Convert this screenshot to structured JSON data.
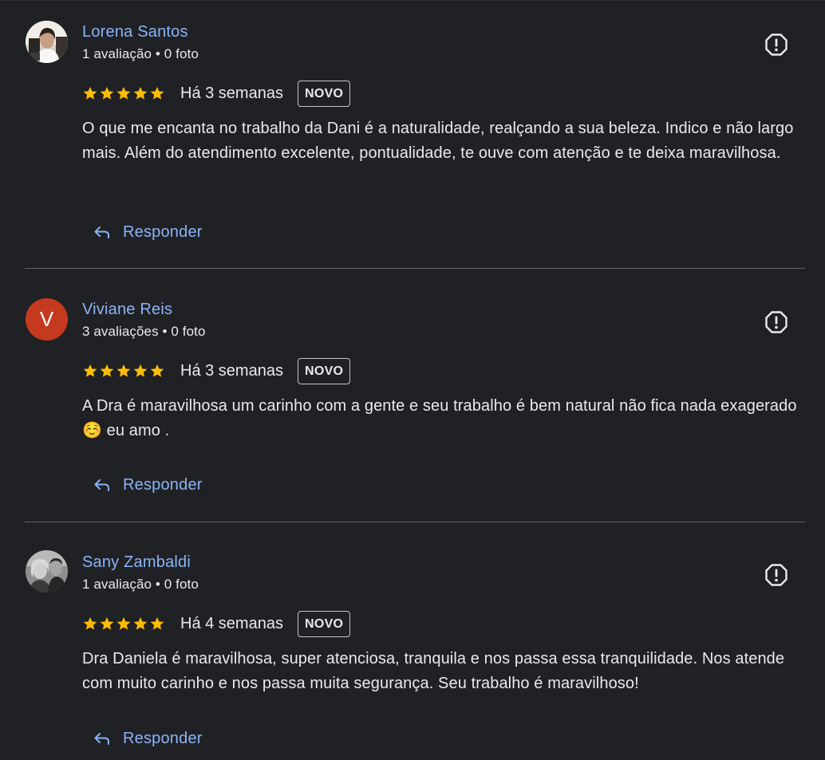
{
  "reviews": [
    {
      "name": "Lorena Santos",
      "meta": "1 avaliação • 0 foto",
      "avatar_type": "photo",
      "rating": 5,
      "date": "Há 3 semanas",
      "badge": "NOVO",
      "text": "O que me encanta no trabalho da Dani é a naturalidade, realçando a sua beleza. Indico e não largo mais. Além do atendimento excelente, pontualidade, te ouve com atenção e te deixa maravilhosa.",
      "reply_label": "Responder"
    },
    {
      "name": "Viviane Reis",
      "meta": "3 avaliações • 0 foto",
      "avatar_type": "letter",
      "avatar_letter": "V",
      "avatar_color": "#c5391f",
      "rating": 5,
      "date": "Há 3 semanas",
      "badge": "NOVO",
      "text": "A Dra é maravilhosa um carinho com a gente e seu trabalho é bem natural não fica nada exagerado ☺️ eu amo .",
      "reply_label": "Responder"
    },
    {
      "name": "Sany Zambaldi",
      "meta": "1 avaliação • 0 foto",
      "avatar_type": "photo",
      "rating": 5,
      "date": "Há 4 semanas",
      "badge": "NOVO",
      "text": "Dra Daniela é maravilhosa, super atenciosa, tranquila e nos passa essa tranquilidade. Nos atende com muito carinho e nos passa muita segurança. Seu trabalho é maravilhoso!",
      "reply_label": "Responder"
    }
  ],
  "icons": {
    "flag": "report-flag-icon",
    "star": "star-icon",
    "reply": "reply-arrow-icon"
  },
  "colors": {
    "background": "#202124",
    "link": "#8ab4f8",
    "star": "#fbbc04",
    "text": "#e8eaed"
  }
}
